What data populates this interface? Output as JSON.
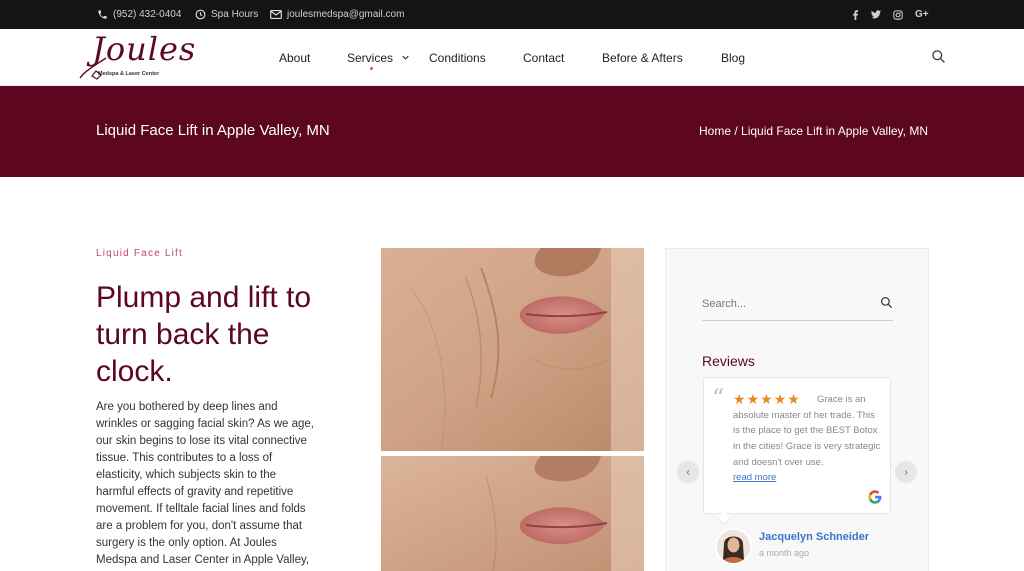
{
  "topbar": {
    "phone": "(952) 432-0404",
    "hours": "Spa Hours",
    "email": "joulesmedspa@gmail.com",
    "social": [
      "f",
      "t",
      "ig",
      "G+"
    ]
  },
  "header": {
    "logo_script": "Joules",
    "logo_sub": "Medspa & Laser Center",
    "nav": {
      "about": "About",
      "services": "Services",
      "conditions": "Conditions",
      "contact": "Contact",
      "before_afters": "Before & Afters",
      "blog": "Blog"
    }
  },
  "banner": {
    "title": "Liquid Face Lift in Apple Valley, MN",
    "breadcrumb_home": "Home",
    "breadcrumb_sep": " / ",
    "breadcrumb_current": "Liquid Face Lift in Apple Valley, MN"
  },
  "main": {
    "eyebrow": "Liquid Face Lift",
    "headline": "Plump and lift to turn back the clock.",
    "body": "Are you bothered by deep lines and wrinkles or sagging facial skin? As we age, our skin begins to lose its vital connective tissue. This contributes to a loss of elasticity, which subjects skin to the harmful effects of gravity and repetitive movement. If telltale facial lines and folds are a problem for you, don't assume that surgery is the only option. At Joules Medspa and Laser Center in Apple Valley,"
  },
  "sidebar": {
    "search_placeholder": "Search...",
    "reviews_title": "Reviews",
    "review": {
      "stars": 5,
      "text": "Grace is an absolute master of her trade. This is the place to get the BEST Botox in the cities! Grace is very strategic and doesn't over use.",
      "read_more": "read more",
      "reviewer": "Jacquelyn Schneider",
      "time": "a month ago"
    },
    "prev_label": "‹",
    "next_label": "›"
  },
  "colors": {
    "brand": "#5c0620",
    "accent": "#c24a63",
    "star": "#e98a1b",
    "link": "#3c74c8"
  }
}
